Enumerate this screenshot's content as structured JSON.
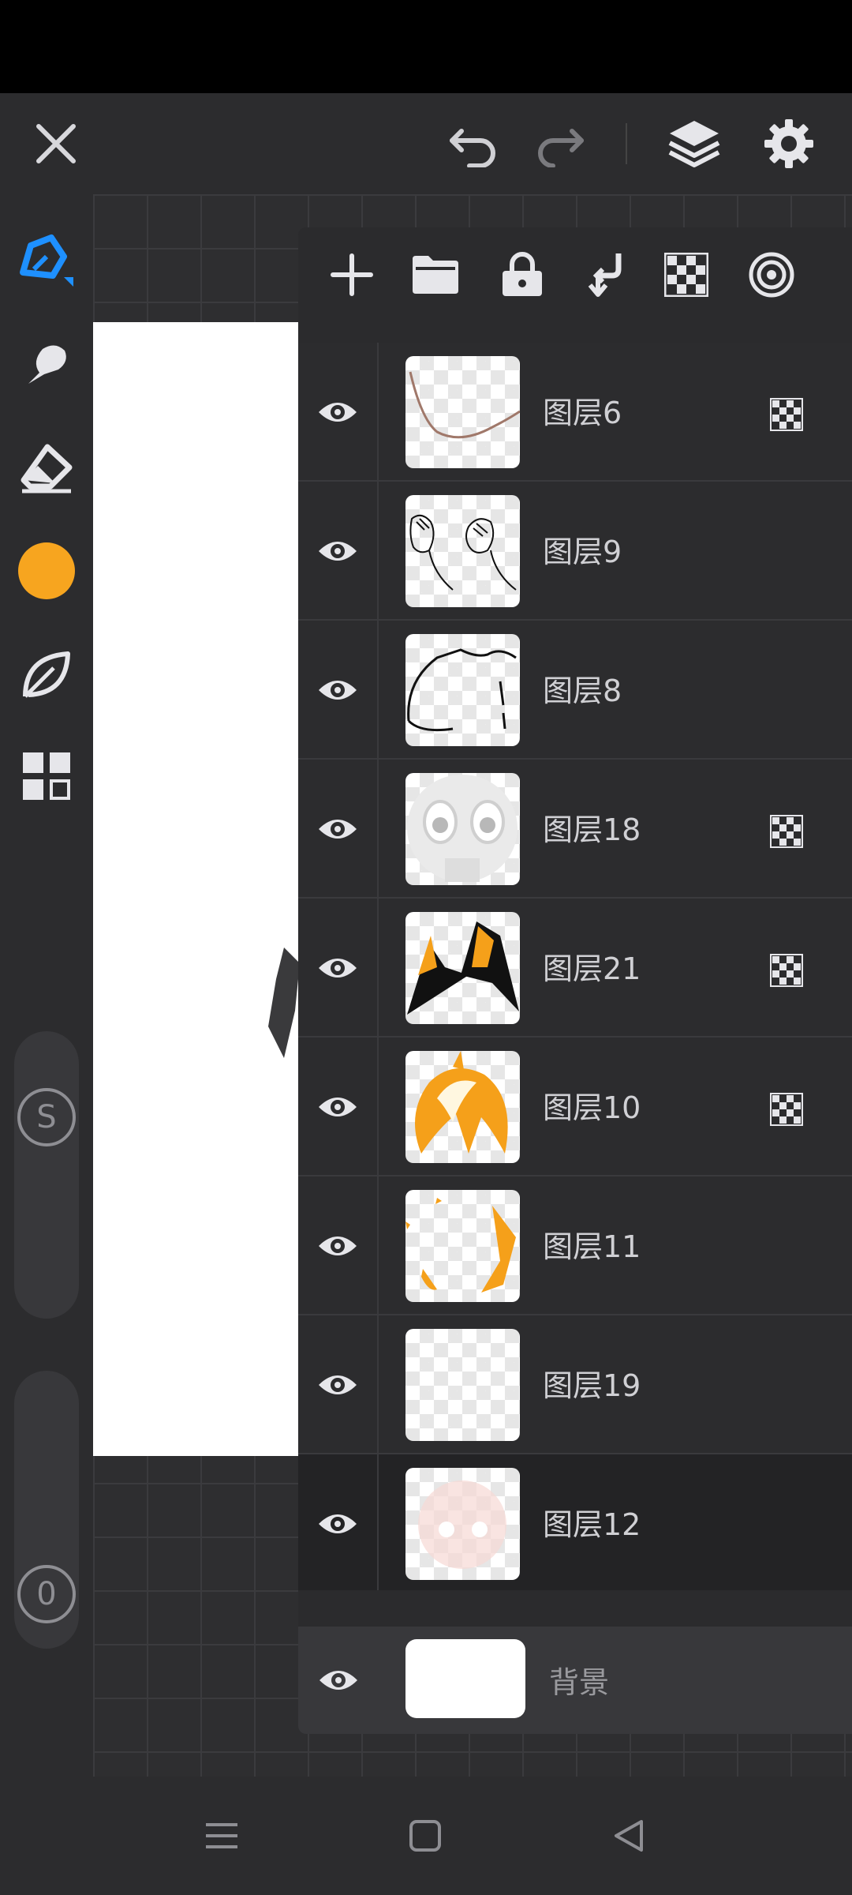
{
  "topbar": {
    "close_icon": "close-icon",
    "undo_icon": "undo-icon",
    "redo_icon": "redo-icon",
    "layers_icon": "layers-icon",
    "settings_icon": "gear-icon"
  },
  "tools": {
    "brush_color": "#1e90ff",
    "current_color": "#f7a51f",
    "size_label": "S",
    "opacity_label": "0"
  },
  "layers_panel": {
    "toolbar": [
      "add-layer",
      "folder",
      "lock",
      "merge-down",
      "transparency",
      "target"
    ],
    "layers": [
      {
        "name": "图层6",
        "mode_icon": true
      },
      {
        "name": "图层9",
        "mode_icon": false
      },
      {
        "name": "图层8",
        "mode_icon": false
      },
      {
        "name": "图层18",
        "mode_icon": true
      },
      {
        "name": "图层21",
        "mode_icon": true
      },
      {
        "name": "图层10",
        "mode_icon": true
      },
      {
        "name": "图层11",
        "mode_icon": false
      },
      {
        "name": "图层19",
        "mode_icon": false
      },
      {
        "name": "图层12",
        "mode_icon": false
      }
    ],
    "background": {
      "name": "背景"
    }
  },
  "navbar": {
    "menu_icon": "menu-icon",
    "home_icon": "home-icon",
    "back_icon": "back-icon"
  }
}
